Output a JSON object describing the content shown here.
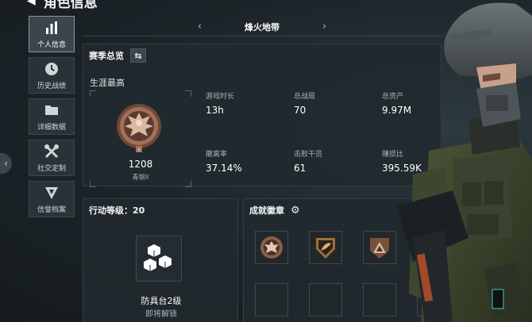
{
  "header": {
    "title": "角色信息"
  },
  "sidebar": {
    "items": [
      {
        "label": "个人信息",
        "icon": "bar-chart-icon",
        "active": true
      },
      {
        "label": "历史战绩",
        "icon": "clock-icon"
      },
      {
        "label": "详细数据",
        "icon": "folder-icon"
      },
      {
        "label": "社交定制",
        "icon": "tools-icon"
      },
      {
        "label": "信誉档案",
        "icon": "shield-icon"
      }
    ]
  },
  "map": {
    "name": "烽火地带"
  },
  "season": {
    "title": "赛季总览",
    "career_label": "生涯最高",
    "rank": {
      "score": "1208",
      "name": "青铜II"
    },
    "stats": [
      {
        "label": "游戏时长",
        "value": "13h"
      },
      {
        "label": "总战局",
        "value": "70"
      },
      {
        "label": "总资产",
        "value": "9.97M"
      },
      {
        "label": "撤离率",
        "value": "37.14%"
      },
      {
        "label": "击败干员",
        "value": "61"
      },
      {
        "label": "赚损比",
        "value": "395.59K"
      }
    ]
  },
  "action": {
    "title": "行动等级：20",
    "bench_name": "防具台2级",
    "bench_status": "即将解锁"
  },
  "achievements": {
    "title": "成就徽章"
  },
  "colors": {
    "accent": "#ffffff",
    "bronze": "#a0705a",
    "panel": "#21292e"
  }
}
